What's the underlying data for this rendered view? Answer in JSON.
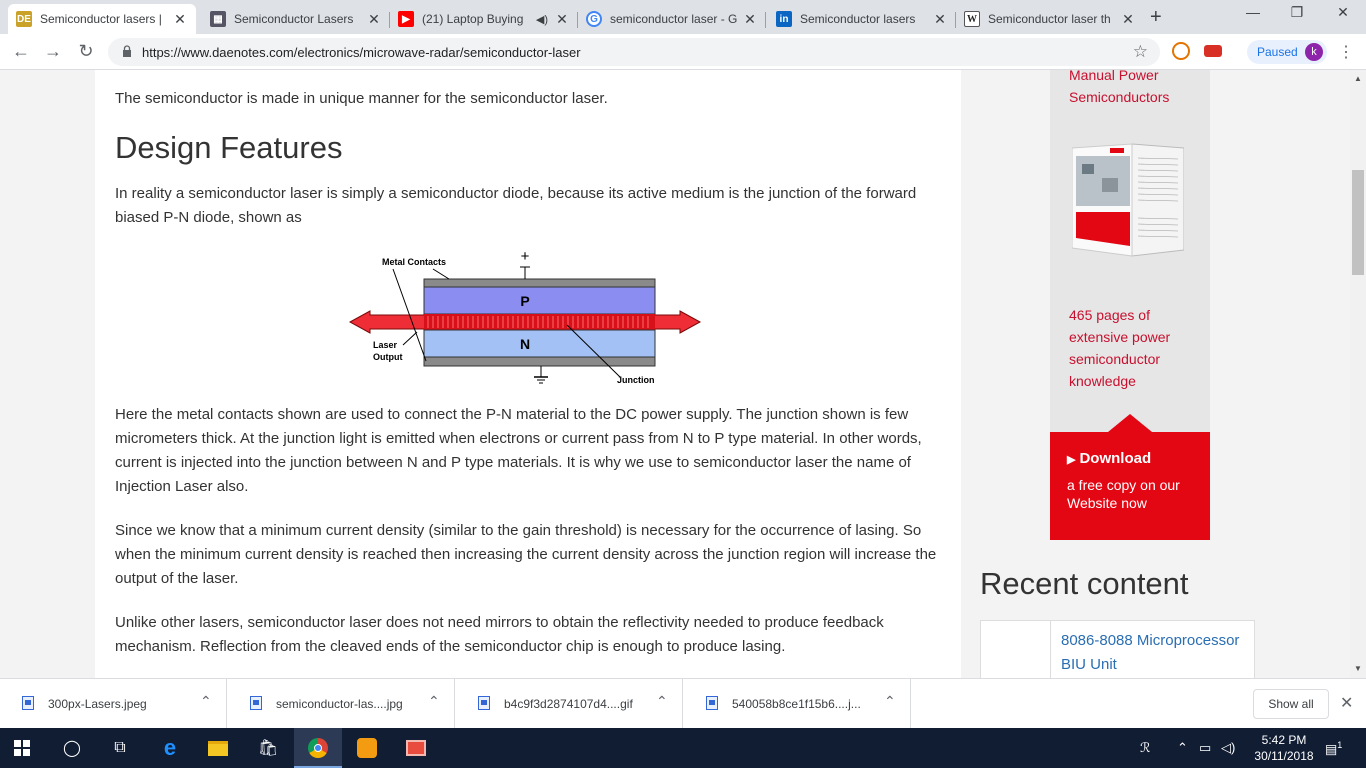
{
  "tabs": [
    {
      "title": "Semiconductor lasers |",
      "favicon": "daenotes-icon",
      "active": true
    },
    {
      "title": "Semiconductor Lasers",
      "favicon": "site-icon"
    },
    {
      "title": "(21) Laptop Buying",
      "favicon": "youtube-icon"
    },
    {
      "title": "semiconductor laser - G",
      "favicon": "google-icon"
    },
    {
      "title": "Semiconductor lasers",
      "favicon": "linkedin-icon"
    },
    {
      "title": "Semiconductor laser th",
      "favicon": "wikipedia-icon"
    }
  ],
  "toolbar": {
    "url": "https://www.daenotes.com/electronics/microwave-radar/semiconductor-laser",
    "paused_label": "Paused",
    "avatar_letter": "k"
  },
  "article": {
    "intro": "The semiconductor is made in unique manner for the semiconductor laser.",
    "heading": "Design Features",
    "para1": "In reality a semiconductor laser is simply a semiconductor diode, because its active medium is the junction of the forward biased P-N diode, shown as",
    "para2": "Here the metal contacts shown are used to connect the P-N material to the DC power supply. The junction shown is few micrometers thick. At the junction light is emitted when electrons or current pass from N to P type material. In other words, current is injected into the junction between N and P type materials. It is why we use to semiconductor laser the name of Injection Laser also.",
    "para3": "Since we know that a minimum current density (similar to the gain threshold) is necessary for the occurrence of lasing. So when the minimum current density is reached then increasing the current density across the junction region will increase the output of the laser.",
    "para4": "Unlike other lasers, semiconductor laser does not need mirrors to obtain the reflectivity needed to produce feedback mechanism. Reflection from the cleaved ends of the semiconductor chip is enough to produce lasing."
  },
  "diagram": {
    "metal_contacts": "Metal Contacts",
    "p_label": "P",
    "n_label": "N",
    "laser_output_1": "Laser",
    "laser_output_2": "Output",
    "junction": "Junction",
    "plus": "+"
  },
  "ad": {
    "top_line1": "Manual Power",
    "top_line2": "Semiconductors",
    "pages_line1": "465 pages of",
    "pages_line2": "extensive power",
    "pages_line3": "semiconductor",
    "pages_line4": "knowledge",
    "download": "Download",
    "sub_line1": "a free copy on our",
    "sub_line2": "Website now",
    "accent": "#e30613"
  },
  "sidebar": {
    "recent_heading": "Recent content",
    "recent_item": "8086-8088 Microprocessor BIU Unit"
  },
  "downloads": [
    {
      "name": "300px-Lasers.jpeg"
    },
    {
      "name": "semiconductor-las....jpg"
    },
    {
      "name": "b4c9f3d2874107d4....gif"
    },
    {
      "name": "540058b8ce1f15b6....j..."
    }
  ],
  "shelf": {
    "show_all": "Show all"
  },
  "taskbar": {
    "time": "5:42 PM",
    "date": "30/11/2018",
    "notifications": "1"
  }
}
